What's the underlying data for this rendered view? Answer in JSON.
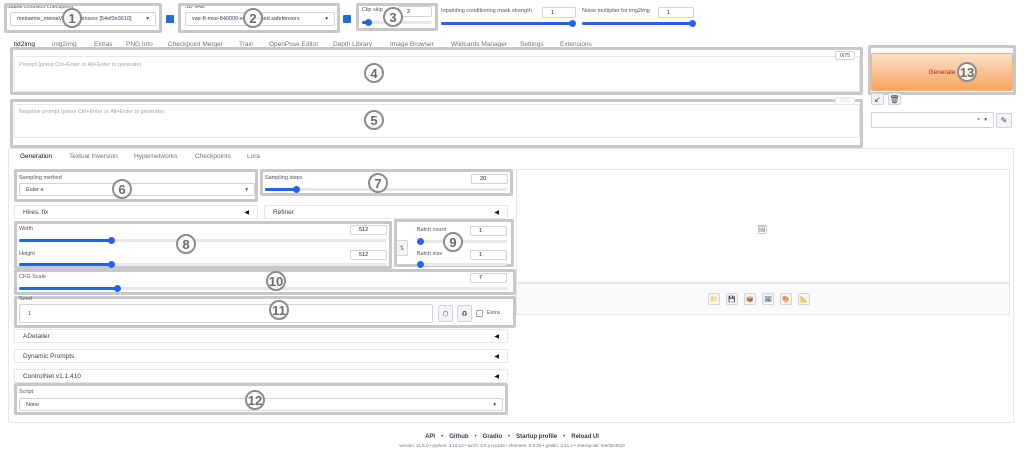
{
  "top": {
    "checkpoint_label": "Stable Diffusion checkpoint",
    "checkpoint_value": "meinamix_meinaV11.safetensors [54ef3e3610]",
    "vae_label": "SD VAE",
    "vae_value": "vae-ft-mse-840000-ema-pruned.safetensors",
    "clip_label": "Clip skip",
    "clip_value": "2",
    "clip_fraction": 0.08,
    "inpaint_label": "Inpainting conditioning mask strength",
    "inpaint_value": "1",
    "noise_label": "Noise multiplier for img2img",
    "noise_value": "1"
  },
  "tabs": [
    "txt2img",
    "img2img",
    "Extras",
    "PNG Info",
    "Checkpoint Merger",
    "Train",
    "OpenPose Editor",
    "Depth Library",
    "Image Browser",
    "Wildcards Manager",
    "Settings",
    "Extensions"
  ],
  "prompt": {
    "placeholder": "Prompt (press Ctrl+Enter or Alt+Enter to generate)",
    "counter": "0/75",
    "neg_placeholder": "Negative prompt (press Ctrl+Enter or Alt+Enter to generate)",
    "neg_counter": "0/75"
  },
  "generate_label": "Generate",
  "subtabs": [
    "Generation",
    "Textual Inversion",
    "Hypernetworks",
    "Checkpoints",
    "Lora"
  ],
  "sampling": {
    "method_label": "Sampling method",
    "method_value": "Euler a",
    "steps_label": "Sampling steps",
    "steps_value": "20",
    "steps_fraction": 0.13
  },
  "hires_label": "Hires. fix",
  "refiner_label": "Refiner",
  "size": {
    "width_label": "Width",
    "width_value": "512",
    "width_fraction": 0.25,
    "height_label": "Height",
    "height_value": "512",
    "height_fraction": 0.25
  },
  "batch": {
    "count_label": "Batch count",
    "count_value": "1",
    "size_label": "Batch size",
    "size_value": "1"
  },
  "cfg": {
    "label": "CFG Scale",
    "value": "7",
    "fraction": 0.2
  },
  "seed": {
    "label": "Seed",
    "value": "1",
    "extra_label": "Extra"
  },
  "accordions": [
    "ADetailer",
    "Dynamic Prompts",
    "ControlNet v1.1.410"
  ],
  "script": {
    "label": "Script",
    "value": "None"
  },
  "callouts": [
    "1",
    "2",
    "3",
    "4",
    "5",
    "6",
    "7",
    "8",
    "9",
    "10",
    "11",
    "12",
    "13"
  ],
  "footer": {
    "links": [
      "API",
      "Github",
      "Gradio",
      "Startup profile",
      "Reload UI"
    ],
    "version": "version: v1.5.0  •  python: 3.10.12  •  torch: 2.0.1+cu118  •  xformers: 0.0.20  •  gradio: 3.41.2  •  checkpoint: 54ef3e3610"
  },
  "colors": {
    "accent": "#2563eb",
    "generate_from": "#fbe1c8",
    "generate_to": "#f7a35c",
    "callout_border": "#c8c8c8"
  }
}
